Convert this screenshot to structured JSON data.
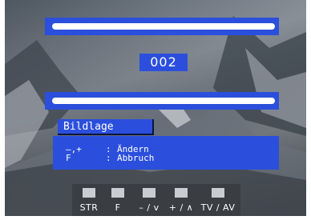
{
  "channel_number": "002",
  "menu_label": "Bildlage",
  "help": [
    {
      "key": "–,+",
      "sep": ":",
      "action": "Ändern"
    },
    {
      "key": "F",
      "sep": ":",
      "action": "Abbruch"
    }
  ],
  "softkeys": [
    {
      "label": "STR"
    },
    {
      "label": "F"
    },
    {
      "label": "– / v"
    },
    {
      "label": "+ / ∧"
    },
    {
      "label": "TV / AV"
    }
  ],
  "colors": {
    "osd_blue": "#2b4fdc",
    "bar_white": "#ffffff",
    "softkey_bg": "#3a3d42"
  }
}
